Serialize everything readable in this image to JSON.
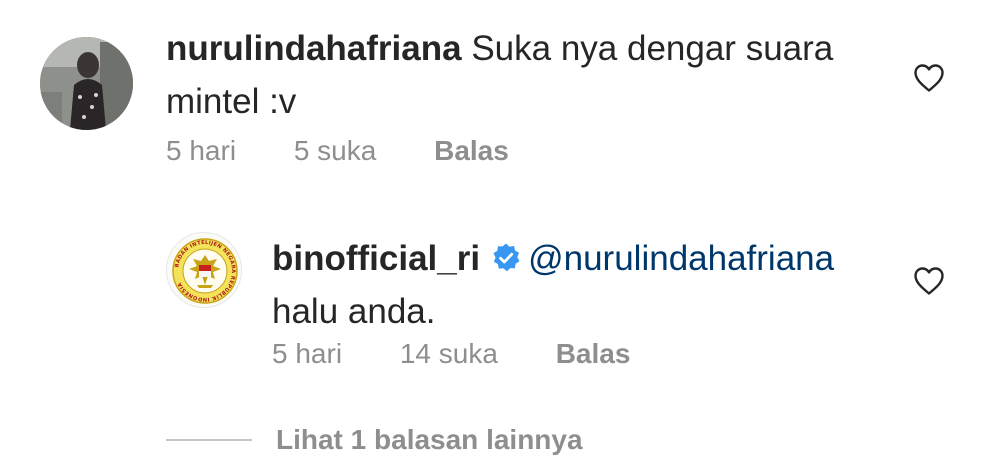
{
  "comments": [
    {
      "username": "nurulindahafriana",
      "text": "Suka nya dengar suara mintel :v",
      "time": "5 hari",
      "likes": "5 suka",
      "reply_label": "Balas",
      "avatar_icon": "user-photo-avatar",
      "like_icon": "heart-outline-icon"
    },
    {
      "username": "binofficial_ri",
      "verified_icon": "verified-badge-icon",
      "mention": "@nurulindahafriana",
      "text": "halu anda.",
      "time": "5 hari",
      "likes": "14 suka",
      "reply_label": "Balas",
      "avatar_icon": "agency-emblem-avatar",
      "avatar_ring_text": "BADAN INTELIJEN NEGARA REPUBLIK INDONESIA",
      "like_icon": "heart-outline-icon"
    }
  ],
  "more_replies": {
    "label": "Lihat 1 balasan lainnya"
  },
  "colors": {
    "text": "#262626",
    "meta": "#8e8e8e",
    "mention": "#00376b",
    "verified": "#3897f0"
  }
}
